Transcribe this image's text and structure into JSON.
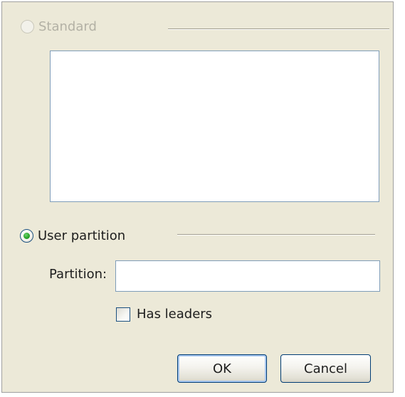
{
  "options": {
    "standard": {
      "label": "Standard",
      "selected": false,
      "enabled": false
    },
    "user_partition": {
      "label": "User partition",
      "selected": true,
      "enabled": true
    }
  },
  "standard_list": {
    "items": []
  },
  "partition_field": {
    "label": "Partition:",
    "value": "",
    "placeholder": ""
  },
  "has_leaders": {
    "label": "Has leaders",
    "checked": false
  },
  "buttons": {
    "ok_label": "OK",
    "cancel_label": "Cancel"
  },
  "colors": {
    "dialog_background": "#ece9d8",
    "control_border": "#7f9db9",
    "radio_selected": "#2aa52a"
  }
}
